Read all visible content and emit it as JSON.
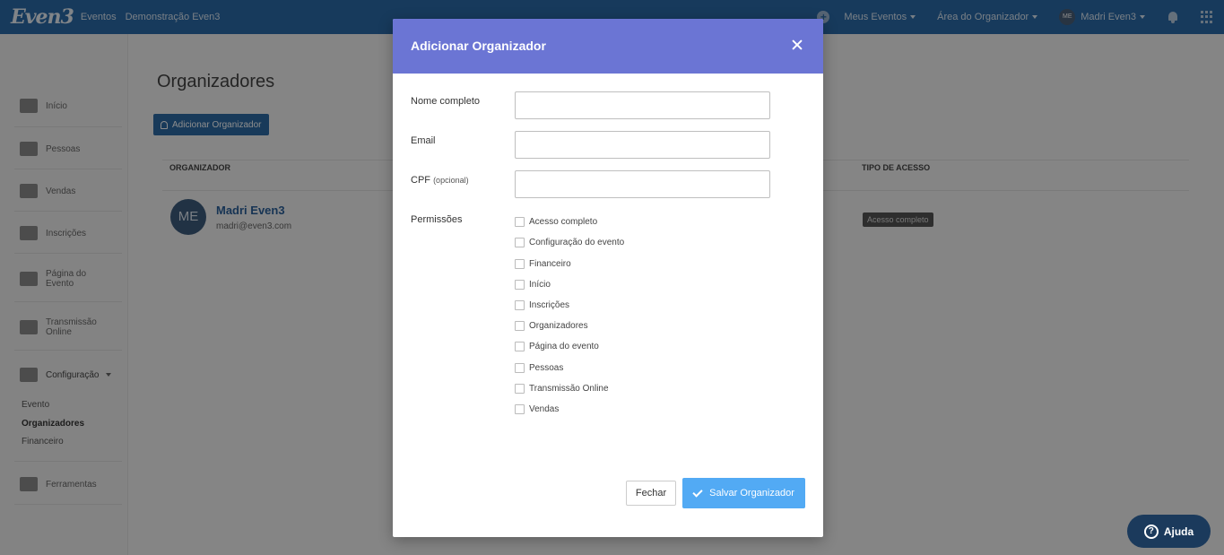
{
  "topbar": {
    "logo": "Even3",
    "crumbs": [
      "Eventos",
      "Demonstração Even3"
    ],
    "my_events": "Meus Eventos",
    "organizer_area": "Área do Organizador",
    "user_initials": "ME",
    "user_name": "Madri Even3"
  },
  "sidebar": {
    "items": [
      "Início",
      "Pessoas",
      "Vendas",
      "Inscrições",
      "Página do Evento",
      "Transmissão Online",
      "Configuração",
      "Ferramentas"
    ],
    "sub_items": [
      "Evento",
      "Organizadores",
      "Financeiro"
    ]
  },
  "main": {
    "title": "Organizadores",
    "add_button": "Adicionar Organizador",
    "columns": [
      "ORGANIZADOR",
      "TIPO DE ACESSO"
    ],
    "rows": [
      {
        "initials": "ME",
        "name": "Madri Even3",
        "email": "madri@even3.com",
        "access": "Acesso completo"
      }
    ]
  },
  "modal": {
    "title": "Adicionar Organizador",
    "fields": {
      "name_label": "Nome completo",
      "email_label": "Email",
      "cpf_label": "CPF",
      "cpf_hint": "(opcional)",
      "name_value": "",
      "email_value": "",
      "cpf_value": ""
    },
    "permissions_label": "Permissões",
    "permissions": [
      "Acesso completo",
      "Configuração do evento",
      "Financeiro",
      "Início",
      "Inscrições",
      "Organizadores",
      "Página do evento",
      "Pessoas",
      "Transmissão Online",
      "Vendas"
    ],
    "close_button": "Fechar",
    "save_button": "Salvar Organizador"
  },
  "help": {
    "label": "Ajuda"
  },
  "colors": {
    "topbar": "#2a6aa8",
    "modal_header": "#6b75d4",
    "save": "#52aaf4",
    "help": "#1b3a5c"
  }
}
